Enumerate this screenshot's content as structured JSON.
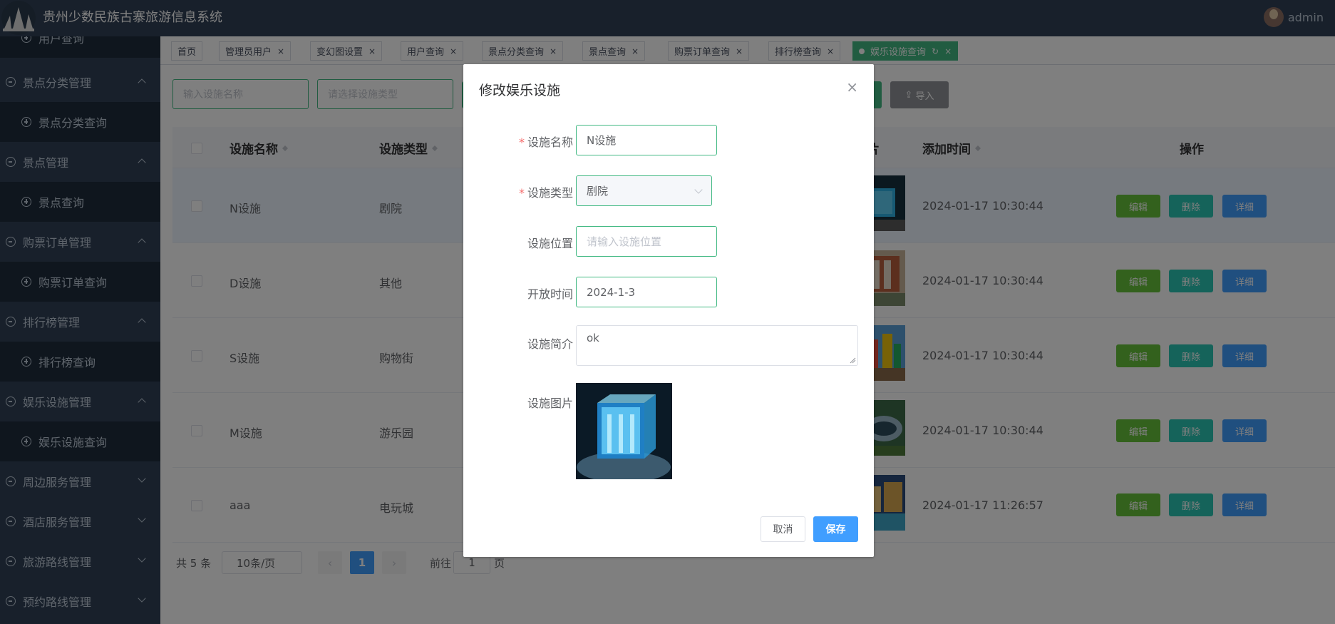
{
  "header": {
    "app_title": "贵州少数民族古寨旅游信息系统",
    "user_name": "admin"
  },
  "sidebar": {
    "items": [
      {
        "label": "用户查询",
        "type": "sub"
      },
      {
        "label": "景点分类管理",
        "type": "group",
        "expanded": true
      },
      {
        "label": "景点分类查询",
        "type": "sub"
      },
      {
        "label": "景点管理",
        "type": "group",
        "expanded": true
      },
      {
        "label": "景点查询",
        "type": "sub"
      },
      {
        "label": "购票订单管理",
        "type": "group",
        "expanded": true
      },
      {
        "label": "购票订单查询",
        "type": "sub"
      },
      {
        "label": "排行榜管理",
        "type": "group",
        "expanded": true
      },
      {
        "label": "排行榜查询",
        "type": "sub"
      },
      {
        "label": "娱乐设施管理",
        "type": "group",
        "expanded": true
      },
      {
        "label": "娱乐设施查询",
        "type": "sub"
      },
      {
        "label": "周边服务管理",
        "type": "group",
        "expanded": false
      },
      {
        "label": "酒店服务管理",
        "type": "group",
        "expanded": false
      },
      {
        "label": "旅游路线管理",
        "type": "group",
        "expanded": false
      },
      {
        "label": "预约路线管理",
        "type": "group",
        "expanded": false
      }
    ]
  },
  "tags": [
    {
      "label": "首页"
    },
    {
      "label": "管理员用户",
      "close": "×"
    },
    {
      "label": "变幻图设置",
      "close": "×"
    },
    {
      "label": "用户查询",
      "close": "×"
    },
    {
      "label": "景点分类查询",
      "close": "×"
    },
    {
      "label": "景点查询",
      "close": "×"
    },
    {
      "label": "购票订单查询",
      "close": "×"
    },
    {
      "label": "排行榜查询",
      "close": "×"
    },
    {
      "label": "娱乐设施查询",
      "close": "×",
      "refresh": "↻",
      "active": true
    }
  ],
  "filters": {
    "name_placeholder": "输入设施名称",
    "type_placeholder": "请选择设施类型",
    "import_label": "导入"
  },
  "table": {
    "headers": {
      "name": "设施名称",
      "type": "设施类型",
      "image": "图片",
      "added": "添加时间",
      "ops": "操作"
    },
    "rows": [
      {
        "name": "N设施",
        "type": "剧院",
        "added": "2024-01-17 10:30:44"
      },
      {
        "name": "D设施",
        "type": "其他",
        "added": "2024-01-17 10:30:44"
      },
      {
        "name": "S设施",
        "type": "购物街",
        "added": "2024-01-17 10:30:44"
      },
      {
        "name": "M设施",
        "type": "游乐园",
        "added": "2024-01-17 10:30:44"
      },
      {
        "name": "aaa",
        "type": "电玩城",
        "added": "2024-01-17 11:26:57"
      }
    ],
    "op_labels": {
      "edit": "编辑",
      "delete": "删除",
      "detail": "详细"
    }
  },
  "pagination": {
    "total": "共 5 条",
    "page_size": "10条/页",
    "prev": "‹",
    "next": "›",
    "current": "1",
    "goto_label": "前往",
    "goto_value": "1",
    "page_suffix": "页"
  },
  "dialog": {
    "title": "修改娱乐设施",
    "close": "×",
    "fields": {
      "name": {
        "label": "设施名称",
        "value": "N设施",
        "required": "*"
      },
      "type": {
        "label": "设施类型",
        "value": "剧院",
        "required": "*"
      },
      "location": {
        "label": "设施位置",
        "placeholder": "请输入设施位置"
      },
      "open_time": {
        "label": "开放时间",
        "value": "2024-1-3"
      },
      "intro": {
        "label": "设施简介",
        "value": "ok"
      },
      "image": {
        "label": "设施图片"
      }
    },
    "cancel_label": "取消",
    "save_label": "保存"
  },
  "colors": {
    "sidebar_bg": "#304156",
    "accent_green": "#42b983",
    "primary_blue": "#409eff"
  }
}
